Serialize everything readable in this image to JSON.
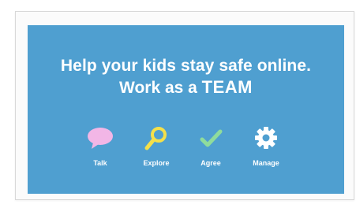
{
  "banner": {
    "headline_line1": "Help your kids stay safe online.",
    "headline_line2_prefix": "Work as a ",
    "headline_line2_emphasis": "TEAM",
    "background_color": "#4f9fd0"
  },
  "steps": [
    {
      "label": "Talk",
      "icon": "speech-bubble-icon",
      "color": "#f2b6e6"
    },
    {
      "label": "Explore",
      "icon": "magnifying-glass-icon",
      "color": "#f4e04a"
    },
    {
      "label": "Agree",
      "icon": "checkmark-icon",
      "color": "#8fdc9c"
    },
    {
      "label": "Manage",
      "icon": "gear-icon",
      "color": "#ffffff"
    }
  ]
}
